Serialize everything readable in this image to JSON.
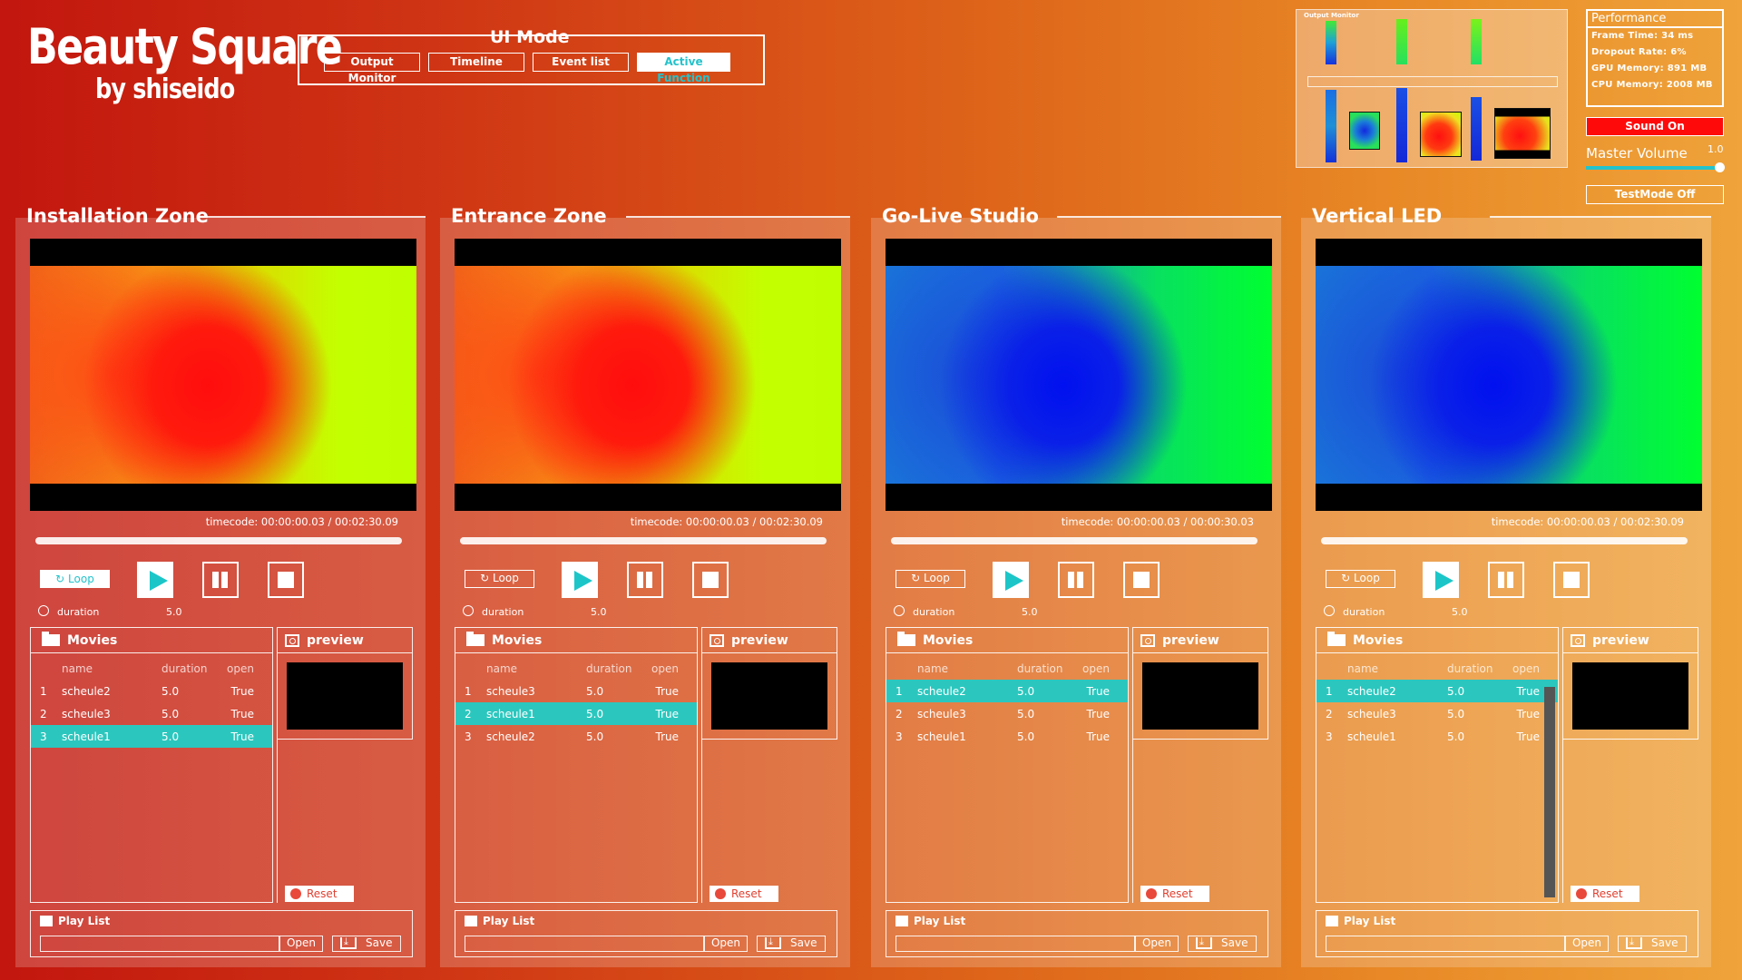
{
  "brand": {
    "title": "Beauty Square",
    "subtitle": "by shiseido"
  },
  "ui_mode": {
    "title": "UI Mode",
    "buttons": [
      "Output Monitor",
      "Timeline",
      "Event list",
      "Active Function"
    ],
    "active": "Active Function"
  },
  "output_monitor": {
    "title": "Output Monitor"
  },
  "performance": {
    "title": "Performance",
    "frame_time": "Frame Time: 34 ms",
    "dropout_rate": "Dropout Rate: 6%",
    "gpu_memory": "GPU Memory: 891 MB",
    "cpu_memory": "CPU Memory: 2008 MB"
  },
  "sound_button": "Sound On",
  "master_volume": {
    "label": "Master Volume",
    "value": "1.0",
    "level": 1.0
  },
  "test_mode_button": "TestMode Off",
  "colors": {
    "accent": "#2bc7be",
    "sound_on": "#ff0a0a"
  },
  "zones": [
    {
      "title": "Installation Zone",
      "timecode": "timecode: 00:00:00.03 / 00:02:30.09",
      "loop_label": "Loop",
      "loop_active": true,
      "duration_label": "duration",
      "duration_value": "5.0",
      "movies_title": "Movies",
      "columns": [
        "name",
        "duration",
        "open"
      ],
      "rows": [
        {
          "idx": "1",
          "name": "scheule2",
          "duration": "5.0",
          "open": "True"
        },
        {
          "idx": "2",
          "name": "scheule3",
          "duration": "5.0",
          "open": "True"
        },
        {
          "idx": "3",
          "name": "scheule1",
          "duration": "5.0",
          "open": "True"
        }
      ],
      "selected_row": 2,
      "preview_title": "preview",
      "reset_label": "Reset",
      "playlist_title": "Play List",
      "open_label": "Open",
      "save_label": "Save",
      "video_palette": "warm"
    },
    {
      "title": "Entrance Zone",
      "timecode": "timecode: 00:00:00.03 / 00:02:30.09",
      "loop_label": "Loop",
      "loop_active": false,
      "duration_label": "duration",
      "duration_value": "5.0",
      "movies_title": "Movies",
      "columns": [
        "name",
        "duration",
        "open"
      ],
      "rows": [
        {
          "idx": "1",
          "name": "scheule3",
          "duration": "5.0",
          "open": "True"
        },
        {
          "idx": "2",
          "name": "scheule1",
          "duration": "5.0",
          "open": "True"
        },
        {
          "idx": "3",
          "name": "scheule2",
          "duration": "5.0",
          "open": "True"
        }
      ],
      "selected_row": 1,
      "preview_title": "preview",
      "reset_label": "Reset",
      "playlist_title": "Play List",
      "open_label": "Open",
      "save_label": "Save",
      "video_palette": "warm"
    },
    {
      "title": "Go-Live Studio",
      "timecode": "timecode: 00:00:00.03 / 00:00:30.03",
      "loop_label": "Loop",
      "loop_active": false,
      "duration_label": "duration",
      "duration_value": "5.0",
      "movies_title": "Movies",
      "columns": [
        "name",
        "duration",
        "open"
      ],
      "rows": [
        {
          "idx": "1",
          "name": "scheule2",
          "duration": "5.0",
          "open": "True"
        },
        {
          "idx": "2",
          "name": "scheule3",
          "duration": "5.0",
          "open": "True"
        },
        {
          "idx": "3",
          "name": "scheule1",
          "duration": "5.0",
          "open": "True"
        }
      ],
      "selected_row": 0,
      "preview_title": "preview",
      "reset_label": "Reset",
      "playlist_title": "Play List",
      "open_label": "Open",
      "save_label": "Save",
      "video_palette": "cool"
    },
    {
      "title": "Vertical LED",
      "timecode": "timecode: 00:00:00.03 / 00:02:30.09",
      "loop_label": "Loop",
      "loop_active": false,
      "duration_label": "duration",
      "duration_value": "5.0",
      "movies_title": "Movies",
      "columns": [
        "name",
        "duration",
        "open"
      ],
      "rows": [
        {
          "idx": "1",
          "name": "scheule2",
          "duration": "5.0",
          "open": "True"
        },
        {
          "idx": "2",
          "name": "scheule3",
          "duration": "5.0",
          "open": "True"
        },
        {
          "idx": "3",
          "name": "scheule1",
          "duration": "5.0",
          "open": "True"
        }
      ],
      "selected_row": 0,
      "preview_title": "preview",
      "reset_label": "Reset",
      "playlist_title": "Play List",
      "open_label": "Open",
      "save_label": "Save",
      "video_palette": "cool"
    }
  ]
}
